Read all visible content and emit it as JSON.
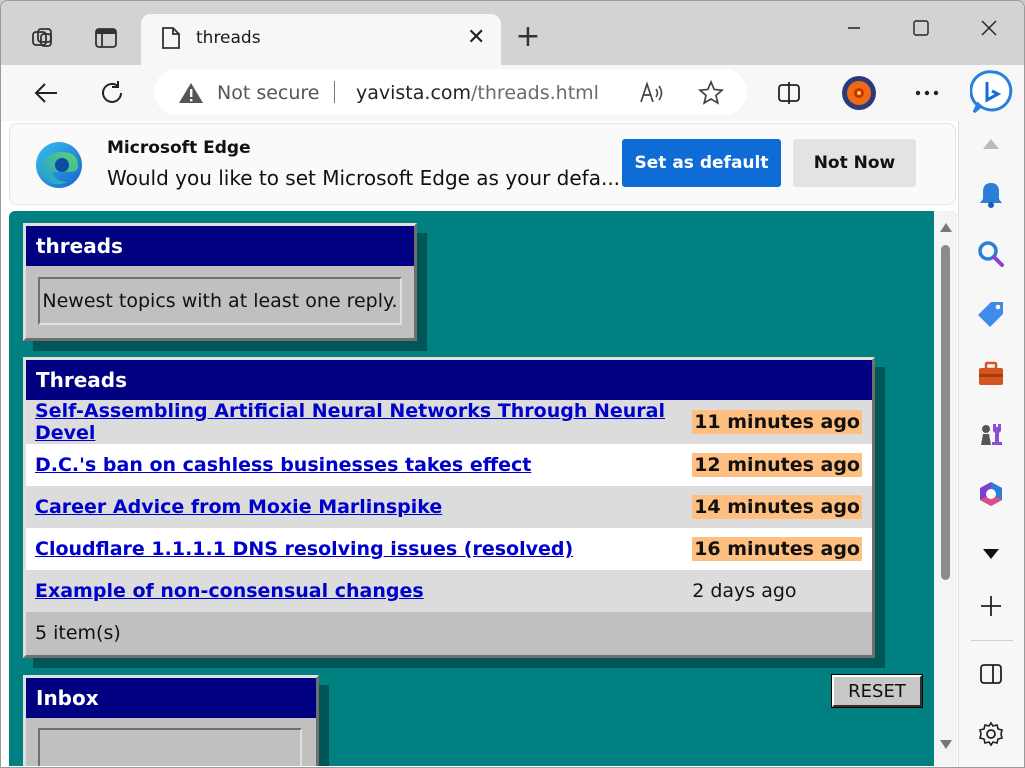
{
  "browser": {
    "tab_title": "threads",
    "omnibox": {
      "security_label": "Not secure",
      "url_domain": "yavista.com",
      "url_path": "/threads.html"
    },
    "colors": {
      "accent": "#0f6cd6",
      "page_background": "#008080",
      "panel_header": "#000080",
      "time_badge": "#ffbf80",
      "link": "#0000cc"
    }
  },
  "notification": {
    "title": "Microsoft Edge",
    "message": "Would you like to set Microsoft Edge as your defa...",
    "primary_button": "Set as default",
    "secondary_button": "Not Now"
  },
  "page": {
    "header_panel": {
      "title": "threads",
      "description": "Newest topics with at least one reply."
    },
    "threads_panel": {
      "title": "Threads",
      "rows": [
        {
          "title": "Self-Assembling Artificial Neural Networks Through Neural Devel",
          "when": "11 minutes ago",
          "highlight": true
        },
        {
          "title": "D.C.'s ban on cashless businesses takes effect",
          "when": "12 minutes ago",
          "highlight": true
        },
        {
          "title": "Career Advice from Moxie Marlinspike",
          "when": "14 minutes ago",
          "highlight": true
        },
        {
          "title": "Cloudflare 1.1.1.1 DNS resolving issues (resolved)",
          "when": "16 minutes ago",
          "highlight": true
        },
        {
          "title": "Example of non-consensual changes",
          "when": "2 days ago",
          "highlight": false
        }
      ],
      "footer": "5 item(s)"
    },
    "reset_button": "RESET",
    "inbox_panel": {
      "title": "Inbox"
    }
  }
}
